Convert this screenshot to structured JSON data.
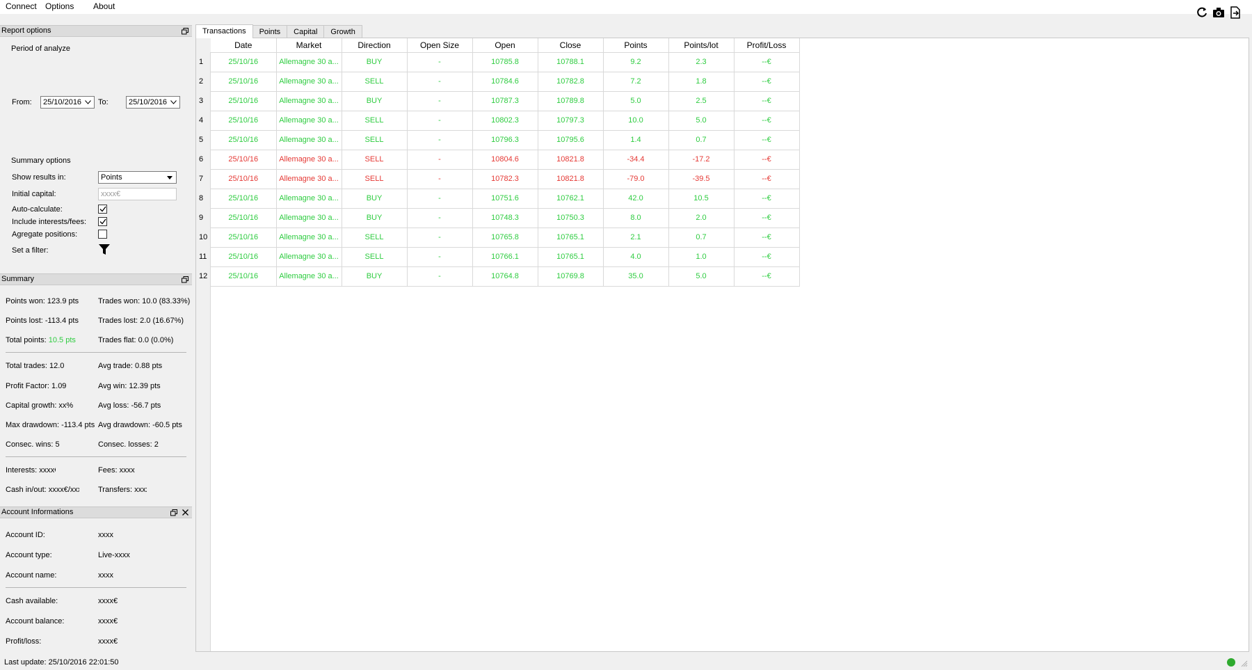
{
  "menu": {
    "connect": "Connect",
    "options": "Options",
    "about": "About"
  },
  "toolbar": {
    "icons": [
      "refresh-icon",
      "camera-icon",
      "export-icon"
    ]
  },
  "report_options": {
    "title": "Report options",
    "period_label": "Period of analyze",
    "from_label": "From:",
    "from_value": "25/10/2016",
    "to_label": "To:",
    "to_value": "25/10/2016",
    "summary_options_label": "Summary options",
    "show_results_label": "Show results in:",
    "show_results_value": "Points",
    "initial_capital_label": "Initial capital:",
    "initial_capital_placeholder": "xxxx€",
    "auto_calculate_label": "Auto-calculate:",
    "auto_calculate_checked": true,
    "include_interests_label": "Include interests/fees:",
    "include_interests_checked": true,
    "aggregate_label": "Agregate positions:",
    "aggregate_checked": false,
    "filter_label": "Set a filter:"
  },
  "summary": {
    "title": "Summary",
    "points_won": "Points won: 123.9 pts",
    "trades_won": "Trades won: 10.0 (83.33%)",
    "points_lost": "Points lost: -113.4 pts",
    "trades_lost": "Trades lost: 2.0 (16.67%)",
    "total_points_label": "Total points:",
    "total_points_value": "10.5 pts",
    "trades_flat": "Trades flat: 0.0 (0.0%)",
    "total_trades": "Total trades: 12.0",
    "avg_trade": "Avg trade: 0.88 pts",
    "profit_factor": "Profit Factor: 1.09",
    "avg_win": "Avg win: 12.39 pts",
    "capital_growth": "Capital growth: xx%",
    "avg_loss": "Avg loss: -56.7 pts",
    "max_drawdown": "Max drawdown: -113.4 pts",
    "avg_drawdown": "Avg drawdown: -60.5 pts",
    "consec_wins": "Consec. wins: 5",
    "consec_losses": "Consec. losses: 2",
    "interests": "Interests: xxxx€",
    "fees": "Fees: xxxx€",
    "cash_inout": "Cash in/out: xxxx€/xxx",
    "transfers": "Transfers: xxxx€"
  },
  "account": {
    "title": "Account Informations",
    "id_label": "Account ID:",
    "id_value": "xxxx",
    "type_label": "Account type:",
    "type_value": "Live-xxxx",
    "name_label": "Account name:",
    "name_value": "xxxx",
    "cash_label": "Cash available:",
    "cash_value": "xxxx€",
    "balance_label": "Account balance:",
    "balance_value": "xxxx€",
    "pl_label": "Profit/loss:",
    "pl_value": "xxxx€"
  },
  "tabs": [
    "Transactions",
    "Points",
    "Capital",
    "Growth"
  ],
  "table": {
    "columns": [
      "Date",
      "Market",
      "Direction",
      "Open Size",
      "Open",
      "Close",
      "Points",
      "Points/lot",
      "Profit/Loss"
    ],
    "rows": [
      {
        "n": "1",
        "date": "25/10/16",
        "market": "Allemagne 30 a...",
        "dir": "BUY",
        "size": "-",
        "open": "10785.8",
        "close": "10788.1",
        "points": "9.2",
        "ppl": "2.3",
        "pl": "--€",
        "color": "green"
      },
      {
        "n": "2",
        "date": "25/10/16",
        "market": "Allemagne 30 a...",
        "dir": "SELL",
        "size": "-",
        "open": "10784.6",
        "close": "10782.8",
        "points": "7.2",
        "ppl": "1.8",
        "pl": "--€",
        "color": "green"
      },
      {
        "n": "3",
        "date": "25/10/16",
        "market": "Allemagne 30 a...",
        "dir": "BUY",
        "size": "-",
        "open": "10787.3",
        "close": "10789.8",
        "points": "5.0",
        "ppl": "2.5",
        "pl": "--€",
        "color": "green"
      },
      {
        "n": "4",
        "date": "25/10/16",
        "market": "Allemagne 30 a...",
        "dir": "SELL",
        "size": "-",
        "open": "10802.3",
        "close": "10797.3",
        "points": "10.0",
        "ppl": "5.0",
        "pl": "--€",
        "color": "green"
      },
      {
        "n": "5",
        "date": "25/10/16",
        "market": "Allemagne 30 a...",
        "dir": "SELL",
        "size": "-",
        "open": "10796.3",
        "close": "10795.6",
        "points": "1.4",
        "ppl": "0.7",
        "pl": "--€",
        "color": "green"
      },
      {
        "n": "6",
        "date": "25/10/16",
        "market": "Allemagne 30 a...",
        "dir": "SELL",
        "size": "-",
        "open": "10804.6",
        "close": "10821.8",
        "points": "-34.4",
        "ppl": "-17.2",
        "pl": "--€",
        "color": "red"
      },
      {
        "n": "7",
        "date": "25/10/16",
        "market": "Allemagne 30 a...",
        "dir": "SELL",
        "size": "-",
        "open": "10782.3",
        "close": "10821.8",
        "points": "-79.0",
        "ppl": "-39.5",
        "pl": "--€",
        "color": "red"
      },
      {
        "n": "8",
        "date": "25/10/16",
        "market": "Allemagne 30 a...",
        "dir": "BUY",
        "size": "-",
        "open": "10751.6",
        "close": "10762.1",
        "points": "42.0",
        "ppl": "10.5",
        "pl": "--€",
        "color": "green"
      },
      {
        "n": "9",
        "date": "25/10/16",
        "market": "Allemagne 30 a...",
        "dir": "BUY",
        "size": "-",
        "open": "10748.3",
        "close": "10750.3",
        "points": "8.0",
        "ppl": "2.0",
        "pl": "--€",
        "color": "green"
      },
      {
        "n": "10",
        "date": "25/10/16",
        "market": "Allemagne 30 a...",
        "dir": "SELL",
        "size": "-",
        "open": "10765.8",
        "close": "10765.1",
        "points": "2.1",
        "ppl": "0.7",
        "pl": "--€",
        "color": "green"
      },
      {
        "n": "11",
        "date": "25/10/16",
        "market": "Allemagne 30 a...",
        "dir": "SELL",
        "size": "-",
        "open": "10766.1",
        "close": "10765.1",
        "points": "4.0",
        "ppl": "1.0",
        "pl": "--€",
        "color": "green"
      },
      {
        "n": "12",
        "date": "25/10/16",
        "market": "Allemagne 30 a...",
        "dir": "BUY",
        "size": "-",
        "open": "10764.8",
        "close": "10769.8",
        "points": "35.0",
        "ppl": "5.0",
        "pl": "--€",
        "color": "green"
      }
    ]
  },
  "status": {
    "last_update": "Last update: 25/10/2016 22:01:50",
    "connection_color": "#2eaa2e"
  },
  "colors": {
    "positive": "#2ecc40",
    "negative": "#e53935"
  }
}
